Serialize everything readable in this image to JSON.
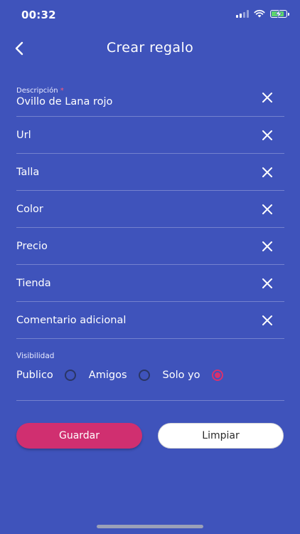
{
  "status_bar": {
    "time": "00:32"
  },
  "header": {
    "title": "Crear regalo"
  },
  "form": {
    "description": {
      "label": "Descripción",
      "required_mark": "*",
      "value": "Ovillo de Lana rojo"
    },
    "fields": [
      {
        "label": "Url"
      },
      {
        "label": "Talla"
      },
      {
        "label": "Color"
      },
      {
        "label": "Precio"
      },
      {
        "label": "Tienda"
      },
      {
        "label": "Comentario adicional"
      }
    ]
  },
  "visibility": {
    "label": "Visibilidad",
    "options": [
      {
        "label": "Publico",
        "selected": false
      },
      {
        "label": "Amigos",
        "selected": false
      },
      {
        "label": "Solo yo",
        "selected": true
      }
    ]
  },
  "actions": {
    "save_label": "Guardar",
    "clear_label": "Limpiar"
  },
  "colors": {
    "background": "#3f53bb",
    "accent": "#d02f70",
    "battery": "#5ed66b"
  }
}
